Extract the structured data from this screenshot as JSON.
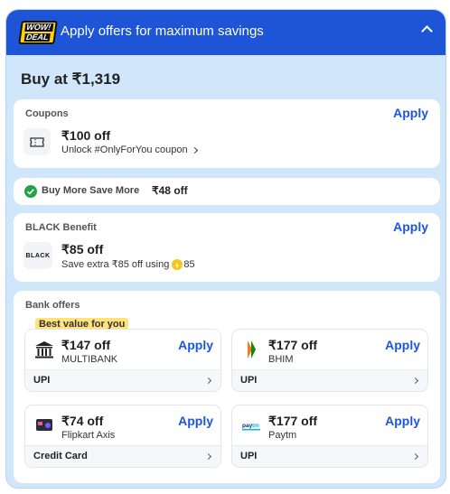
{
  "banner": {
    "badge_line1": "WOW!",
    "badge_line2": "DEAL",
    "title": "Apply offers for maximum savings"
  },
  "buy_at": "Buy at ₹1,319",
  "coupons": {
    "label": "Coupons",
    "apply": "Apply",
    "price": "₹100 off",
    "desc": "Unlock #OnlyForYou coupon"
  },
  "buymore": {
    "label": "Buy More Save More",
    "amount": "₹48 off"
  },
  "black": {
    "label": "BLACK Benefit",
    "apply": "Apply",
    "logo": "BLACK",
    "price": "₹85 off",
    "desc": "Save extra ₹85 off using",
    "coins": "85"
  },
  "bank": {
    "label": "Bank offers",
    "best_tag": "Best value for you",
    "offers": [
      {
        "price": "₹147 off",
        "name": "MULTIBANK",
        "apply": "Apply",
        "footer": "UPI"
      },
      {
        "price": "₹177 off",
        "name": "BHIM",
        "apply": "Apply",
        "footer": "UPI"
      },
      {
        "price": "₹74 off",
        "name": "Flipkart Axis",
        "apply": "Apply",
        "footer": "Credit Card"
      },
      {
        "price": "₹177 off",
        "name": "Paytm",
        "apply": "Apply",
        "footer": "UPI"
      }
    ]
  },
  "colors": {
    "accent": "#1b56e0",
    "banner": "#1e55d6",
    "panel": "#cfe6fb",
    "tag": "#ffe27a",
    "check": "#25a244"
  }
}
